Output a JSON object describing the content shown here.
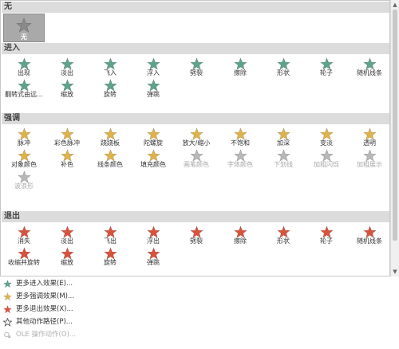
{
  "colors": {
    "entrance": "#5fa38a",
    "emphasis": "#e0b24a",
    "exit": "#d9523b",
    "none": "#8a8a8a",
    "disabled": "#b8b8b8"
  },
  "sections": [
    {
      "title": "无",
      "icon_kind": "none",
      "items": [
        {
          "label": "无",
          "selected": true
        }
      ]
    },
    {
      "title": "进入",
      "icon_kind": "entrance",
      "items": [
        {
          "label": "出现"
        },
        {
          "label": "淡出"
        },
        {
          "label": "飞入"
        },
        {
          "label": "浮入"
        },
        {
          "label": "劈裂"
        },
        {
          "label": "擦除"
        },
        {
          "label": "形状"
        },
        {
          "label": "轮子"
        },
        {
          "label": "随机线条"
        },
        {
          "label": "翻转式由远..."
        },
        {
          "label": "缩放"
        },
        {
          "label": "旋转"
        },
        {
          "label": "弹跳"
        }
      ]
    },
    {
      "title": "强调",
      "icon_kind": "emphasis",
      "items": [
        {
          "label": "脉冲"
        },
        {
          "label": "彩色脉冲"
        },
        {
          "label": "跷跷板"
        },
        {
          "label": "陀螺旋"
        },
        {
          "label": "放大/缩小"
        },
        {
          "label": "不饱和"
        },
        {
          "label": "加深"
        },
        {
          "label": "变淡"
        },
        {
          "label": "透明"
        },
        {
          "label": "对象颜色"
        },
        {
          "label": "补色"
        },
        {
          "label": "线条颜色"
        },
        {
          "label": "填充颜色"
        },
        {
          "label": "画笔颜色",
          "disabled": true
        },
        {
          "label": "字体颜色",
          "disabled": true
        },
        {
          "label": "下划线",
          "disabled": true
        },
        {
          "label": "加粗闪烁",
          "disabled": true
        },
        {
          "label": "加粗展示",
          "disabled": true
        },
        {
          "label": "波浪形",
          "disabled": true
        }
      ]
    },
    {
      "title": "退出",
      "icon_kind": "exit",
      "items": [
        {
          "label": "消失"
        },
        {
          "label": "淡出"
        },
        {
          "label": "飞出"
        },
        {
          "label": "浮出"
        },
        {
          "label": "劈裂"
        },
        {
          "label": "擦除"
        },
        {
          "label": "形状"
        },
        {
          "label": "轮子"
        },
        {
          "label": "随机线条"
        },
        {
          "label": "收缩并旋转"
        },
        {
          "label": "缩放"
        },
        {
          "label": "旋转"
        },
        {
          "label": "弹跳"
        }
      ]
    }
  ],
  "menu": [
    {
      "label": "更多进入效果(E)...",
      "icon_kind": "entrance"
    },
    {
      "label": "更多强调效果(M)...",
      "icon_kind": "emphasis"
    },
    {
      "label": "更多退出效果(X)...",
      "icon_kind": "exit"
    },
    {
      "label": "其他动作路径(P)...",
      "icon_kind": "path"
    },
    {
      "label": "OLE 操作动作(O)...",
      "icon_kind": "ole",
      "disabled": true
    }
  ]
}
